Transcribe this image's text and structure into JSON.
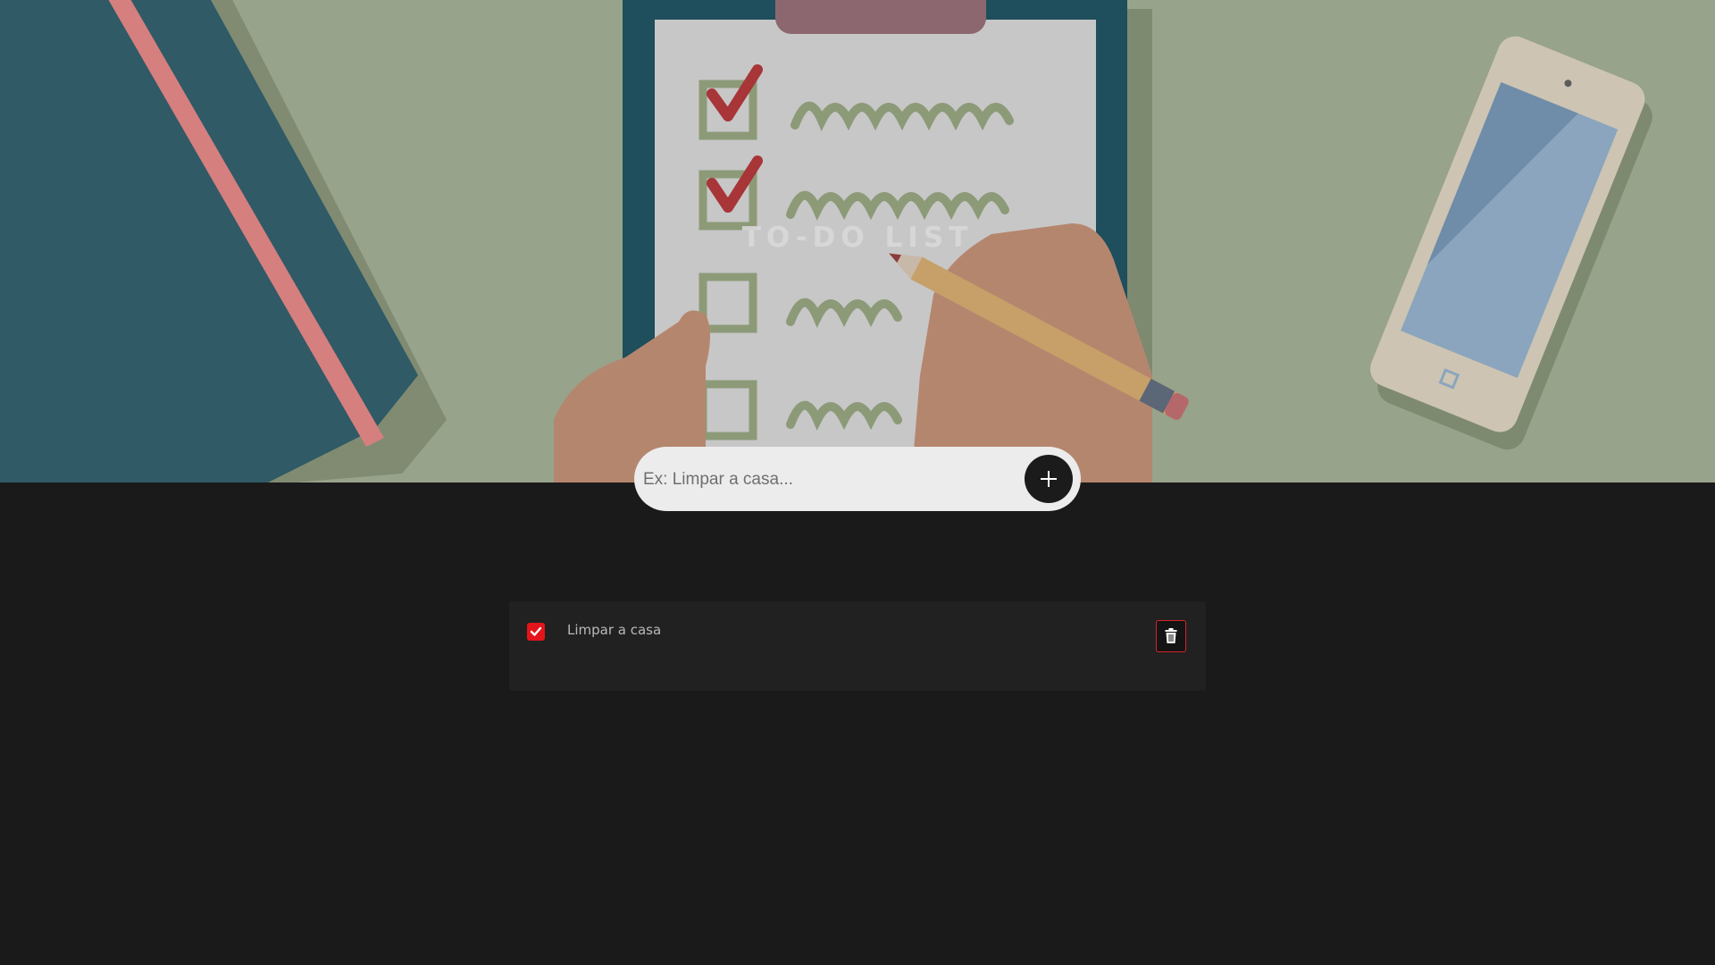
{
  "header": {
    "title": "TO-DO LIST"
  },
  "add_task": {
    "placeholder": "Ex: Limpar a casa...",
    "value": "",
    "button_icon": "plus-icon"
  },
  "tasks": [
    {
      "label": "Limpar a casa",
      "checked": true,
      "delete_icon": "trash-icon"
    }
  ],
  "colors": {
    "page_background": "#1a1a1a",
    "task_background": "#212121",
    "accent_red": "#e4141b",
    "input_background": "#ececec"
  }
}
